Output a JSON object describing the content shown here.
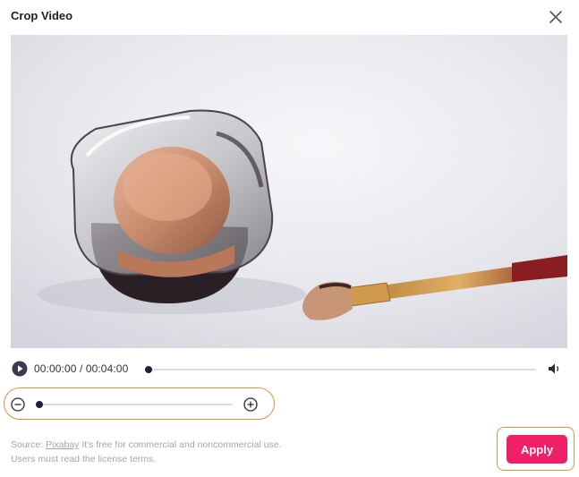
{
  "dialog": {
    "title": "Crop Video"
  },
  "player": {
    "current_time": "00:00:00",
    "separator": " / ",
    "duration": "00:04:00",
    "progress": 0.0
  },
  "zoom": {
    "level": 0.0
  },
  "footer": {
    "source_prefix": "Source: ",
    "source_link": "Pixabay",
    "source_suffix": " It's free for commercial and noncommercial use.",
    "license_note": "Users must read the license terms.",
    "apply_label": "Apply"
  },
  "colors": {
    "accent": "#ef1f68",
    "highlight_ring": "#e8913b",
    "slider_knob": "#1f1f3a"
  },
  "icons": {
    "close": "close-icon",
    "play": "play-icon",
    "volume": "volume-icon",
    "zoom_out": "zoom-out-icon",
    "zoom_in": "zoom-in-icon"
  }
}
